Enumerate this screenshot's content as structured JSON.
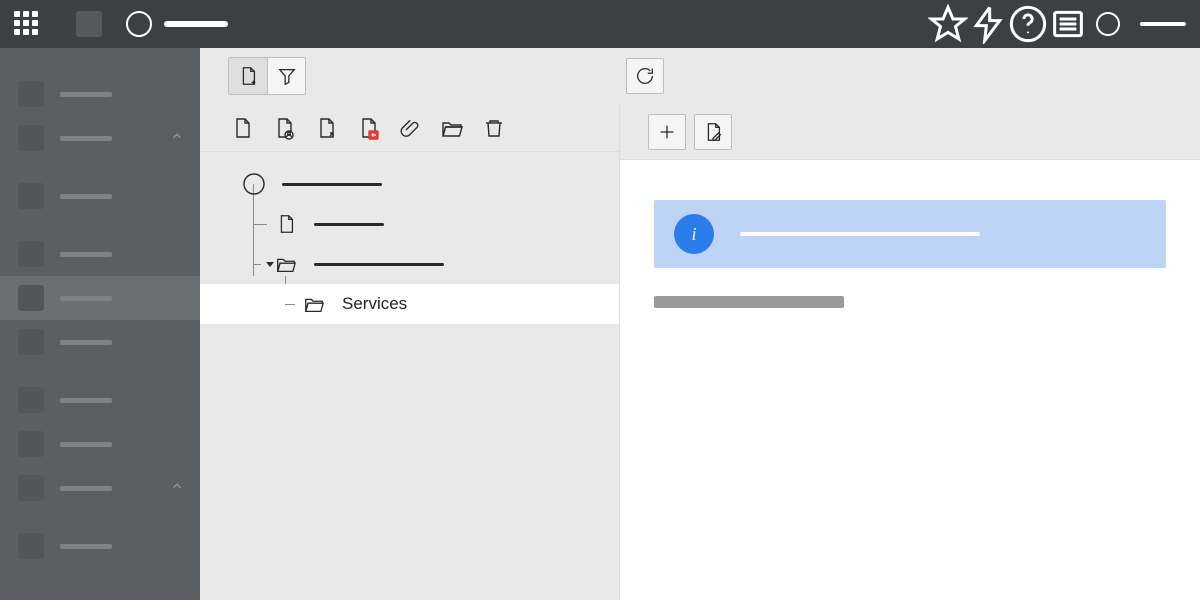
{
  "topbar": {
    "apps_tooltip": "Apps",
    "icons": [
      "star",
      "bolt",
      "help",
      "list",
      "user"
    ]
  },
  "sidebar": {
    "groups": [
      {
        "items": [
          {},
          {}
        ],
        "collapsible": true
      },
      {
        "items": [
          {},
          {
            "selected": true
          },
          {},
          {},
          {},
          {}
        ],
        "collapsible": true
      }
    ]
  },
  "tree": {
    "root": {
      "kind": "circle"
    },
    "children": [
      {
        "kind": "document"
      },
      {
        "kind": "folder-open",
        "expanded": true,
        "children": [
          {
            "kind": "folder-open",
            "label": "Services",
            "selected": true
          }
        ]
      }
    ]
  },
  "detail": {
    "info_glyph": "i"
  }
}
